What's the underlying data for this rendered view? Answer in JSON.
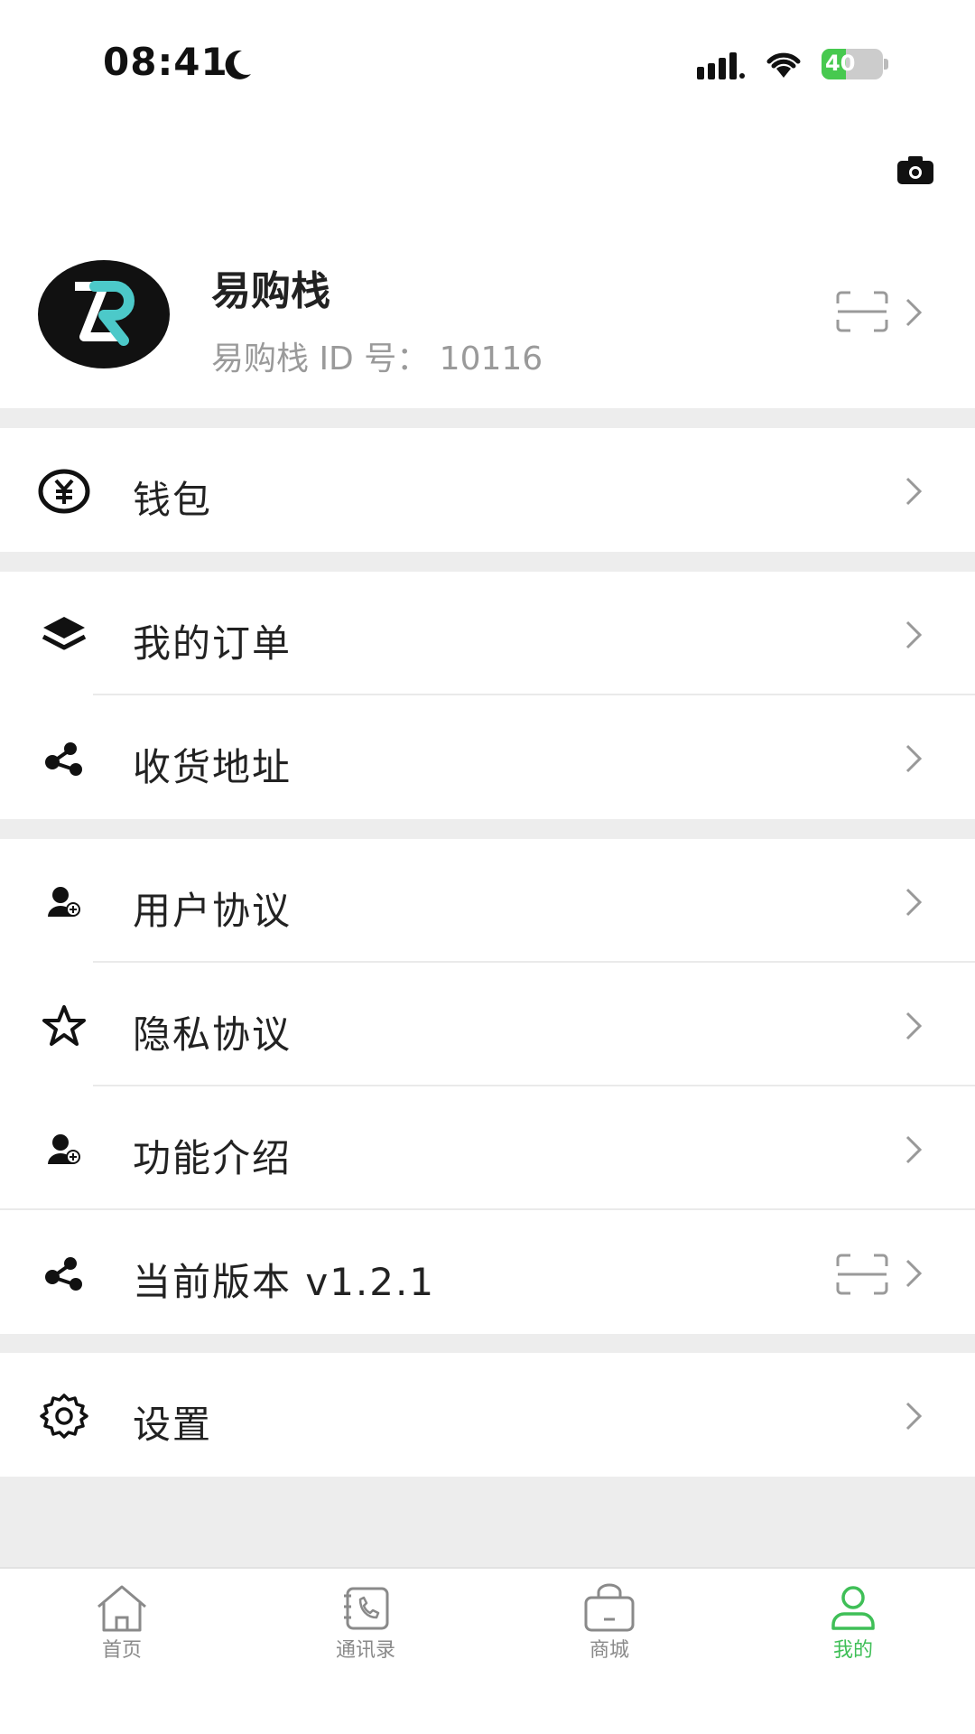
{
  "status_bar": {
    "time": "08:41",
    "battery": "40"
  },
  "profile": {
    "name": "易购栈",
    "id_label": "易购栈 ID 号： 10116"
  },
  "menu": {
    "wallet": "钱包",
    "orders": "我的订单",
    "address": "收货地址",
    "user_agreement": "用户协议",
    "privacy": "隐私协议",
    "features": "功能介绍",
    "version": "当前版本 v1.2.1",
    "settings": "设置"
  },
  "tabs": [
    {
      "label": "首页",
      "icon": "home-icon"
    },
    {
      "label": "通讯录",
      "icon": "contacts-icon"
    },
    {
      "label": "商城",
      "icon": "shop-bag-icon"
    },
    {
      "label": "我的",
      "icon": "person-icon",
      "active": true
    }
  ],
  "colors": {
    "accent": "#3fbf57",
    "logo_teal": "#4cc9c9"
  }
}
